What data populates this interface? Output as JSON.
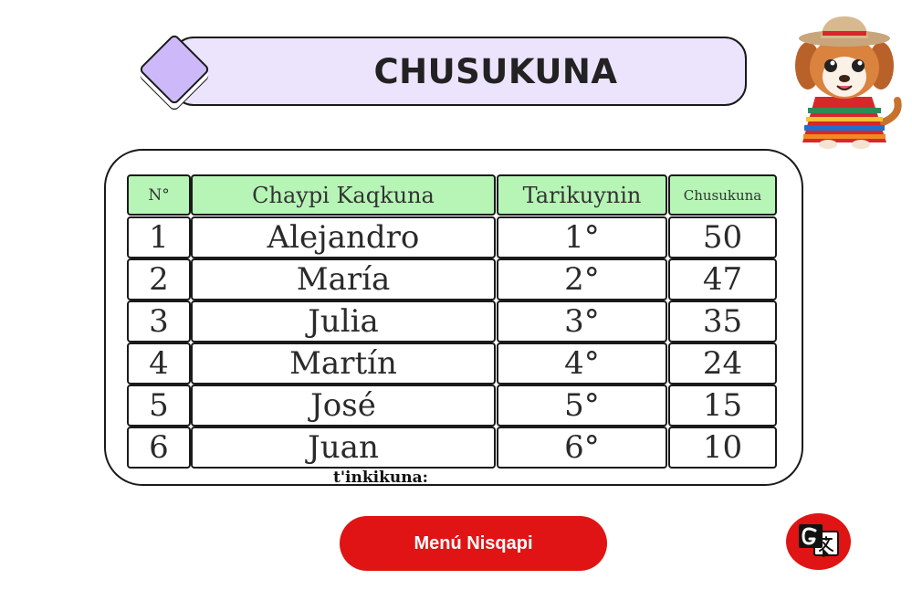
{
  "header": {
    "title": "CHUSUKUNA"
  },
  "table": {
    "columns": [
      "N°",
      "Chaypi Kaqkuna",
      "Tarikuynin",
      "Chusukuna"
    ],
    "rows": [
      {
        "n": "1",
        "name": "Alejandro",
        "position": "1°",
        "score": "50"
      },
      {
        "n": "2",
        "name": "María",
        "position": "2°",
        "score": "47"
      },
      {
        "n": "3",
        "name": "Julia",
        "position": "3°",
        "score": "35"
      },
      {
        "n": "4",
        "name": "Martín",
        "position": "4°",
        "score": "24"
      },
      {
        "n": "5",
        "name": "José",
        "position": "5°",
        "score": "15"
      },
      {
        "n": "6",
        "name": "Juan",
        "position": "6°",
        "score": "10"
      }
    ]
  },
  "footer": {
    "label": "t'inkikuna:",
    "menu_button": "Menú Nisqapi",
    "translate_icon": "translate-icon"
  },
  "colors": {
    "banner_bg": "#ece3fd",
    "diamond": "#cdb9fa",
    "header_cell": "#b6f5b6",
    "button": "#e01414"
  }
}
